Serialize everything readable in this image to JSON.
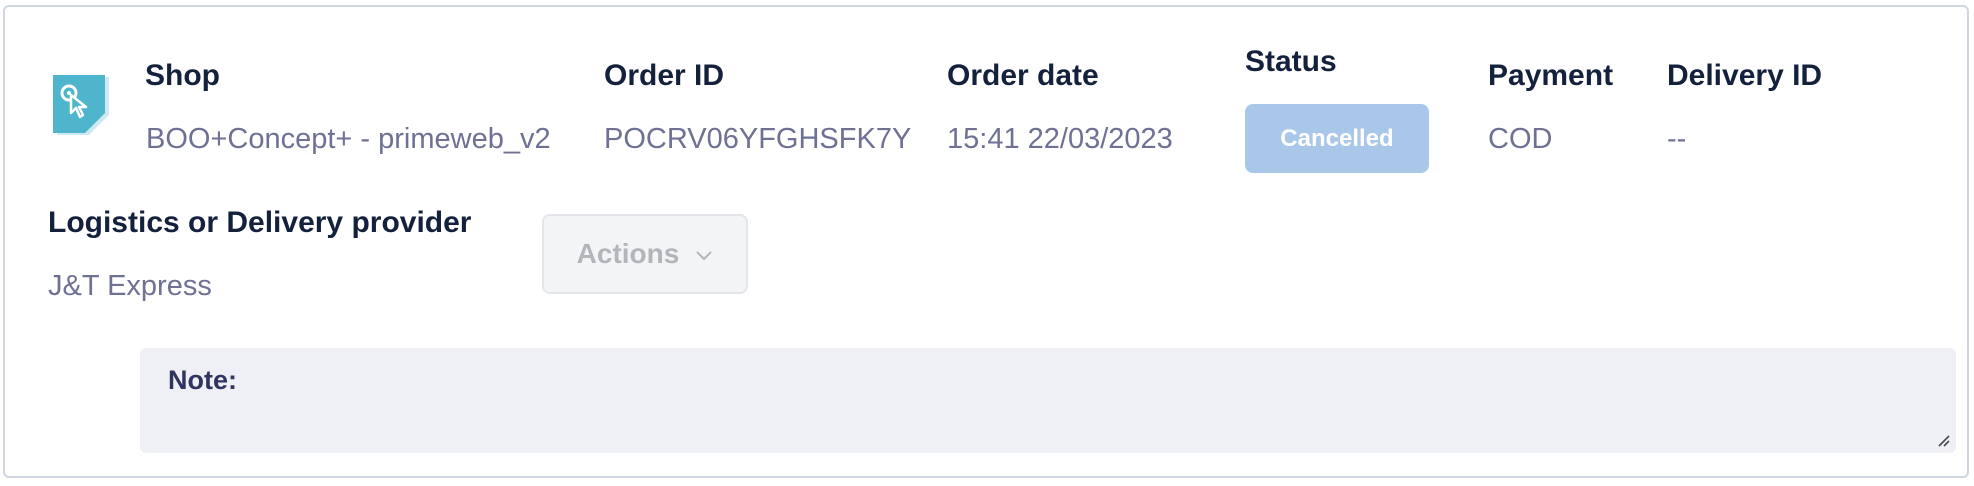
{
  "order": {
    "shop": {
      "label": "Shop",
      "value": "BOO+Concept+ - primeweb_v2"
    },
    "order_id": {
      "label": "Order ID",
      "value": "POCRV06YFGHSFK7Y"
    },
    "order_date": {
      "label": "Order date",
      "value": "15:41 22/03/2023"
    },
    "status": {
      "label": "Status",
      "value": "Cancelled",
      "badge_color": "#a9c7e8"
    },
    "payment": {
      "label": "Payment",
      "value": "COD"
    },
    "delivery_id": {
      "label": "Delivery ID",
      "value": "--"
    },
    "logistics": {
      "label": "Logistics or Delivery provider",
      "value": "J&T Express"
    }
  },
  "actions": {
    "label": "Actions",
    "icon": "chevron-down-icon"
  },
  "note": {
    "label": "Note:",
    "value": ""
  },
  "icons": {
    "shop": "shop-tag-icon"
  },
  "colors": {
    "label": "#14213d",
    "value": "#6e7194",
    "icon_teal": "#4eb5cc",
    "note_background": "#eff0f5"
  }
}
